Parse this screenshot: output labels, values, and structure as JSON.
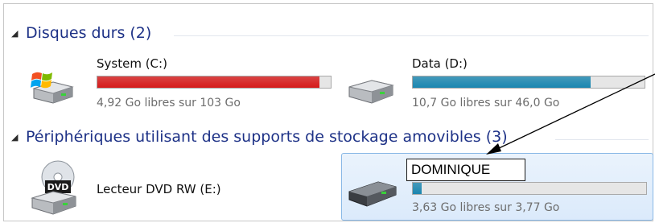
{
  "groups": [
    {
      "label": "Disques durs (2)"
    },
    {
      "label": "Périphériques utilisant des supports de stockage amovibles (3)"
    }
  ],
  "drives": {
    "c": {
      "name": "System (C:)",
      "free_text": "4,92 Go libres sur 103 Go",
      "used_fraction": 0.952,
      "color": "#d61a1a",
      "icon": "windows-hard-drive-icon"
    },
    "d": {
      "name": "Data (D:)",
      "free_text": "10,7 Go libres sur 46,0 Go",
      "used_fraction": 0.767,
      "color": "#1a86b0",
      "icon": "hard-drive-icon"
    },
    "e": {
      "name": "Lecteur DVD RW (E:)",
      "icon": "dvd-drive-icon",
      "badge": "DVD"
    },
    "usb": {
      "name_input": "DOMINIQUE",
      "free_text": "3,63 Go libres sur 3,77 Go",
      "used_fraction": 0.037,
      "color": "#1a86b0",
      "icon": "usb-drive-icon"
    }
  }
}
